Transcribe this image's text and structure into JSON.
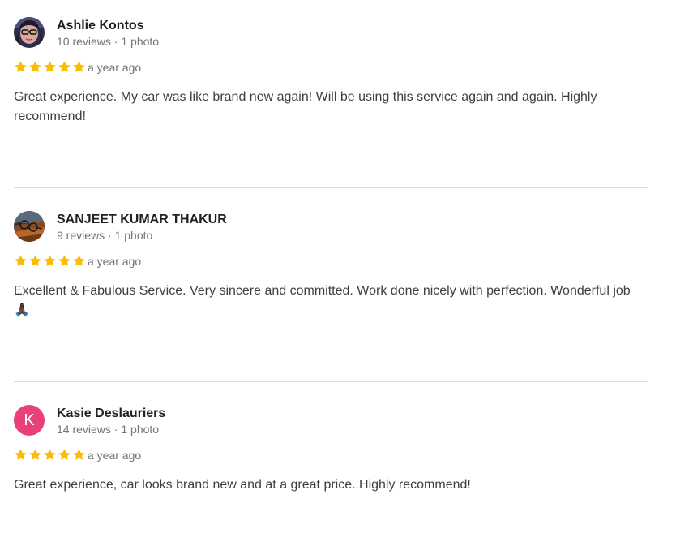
{
  "reviews": [
    {
      "name": "Ashlie Kontos",
      "meta": "10 reviews · 1 photo",
      "rating": 5,
      "date": "a year ago",
      "text": "Great experience. My car was like brand new again! Will be using this service again and again. Highly recommend!"
    },
    {
      "name": "SANJEET KUMAR THAKUR",
      "meta": "9 reviews · 1 photo",
      "rating": 5,
      "date": "a year ago",
      "text": "Excellent & Fabulous Service. Very sincere and committed. Work done nicely with perfection. Wonderful job 🙏🏿"
    },
    {
      "name": "Kasie Deslauriers",
      "meta": "14 reviews · 1 photo",
      "rating": 5,
      "date": "a year ago",
      "avatar_letter": "K",
      "text": "Great experience, car looks brand new and at a great price. Highly recommend!"
    }
  ],
  "colors": {
    "star": "#fbbc04",
    "avatar_letter_bg": "#e8417a",
    "divider": "#dadce0"
  }
}
